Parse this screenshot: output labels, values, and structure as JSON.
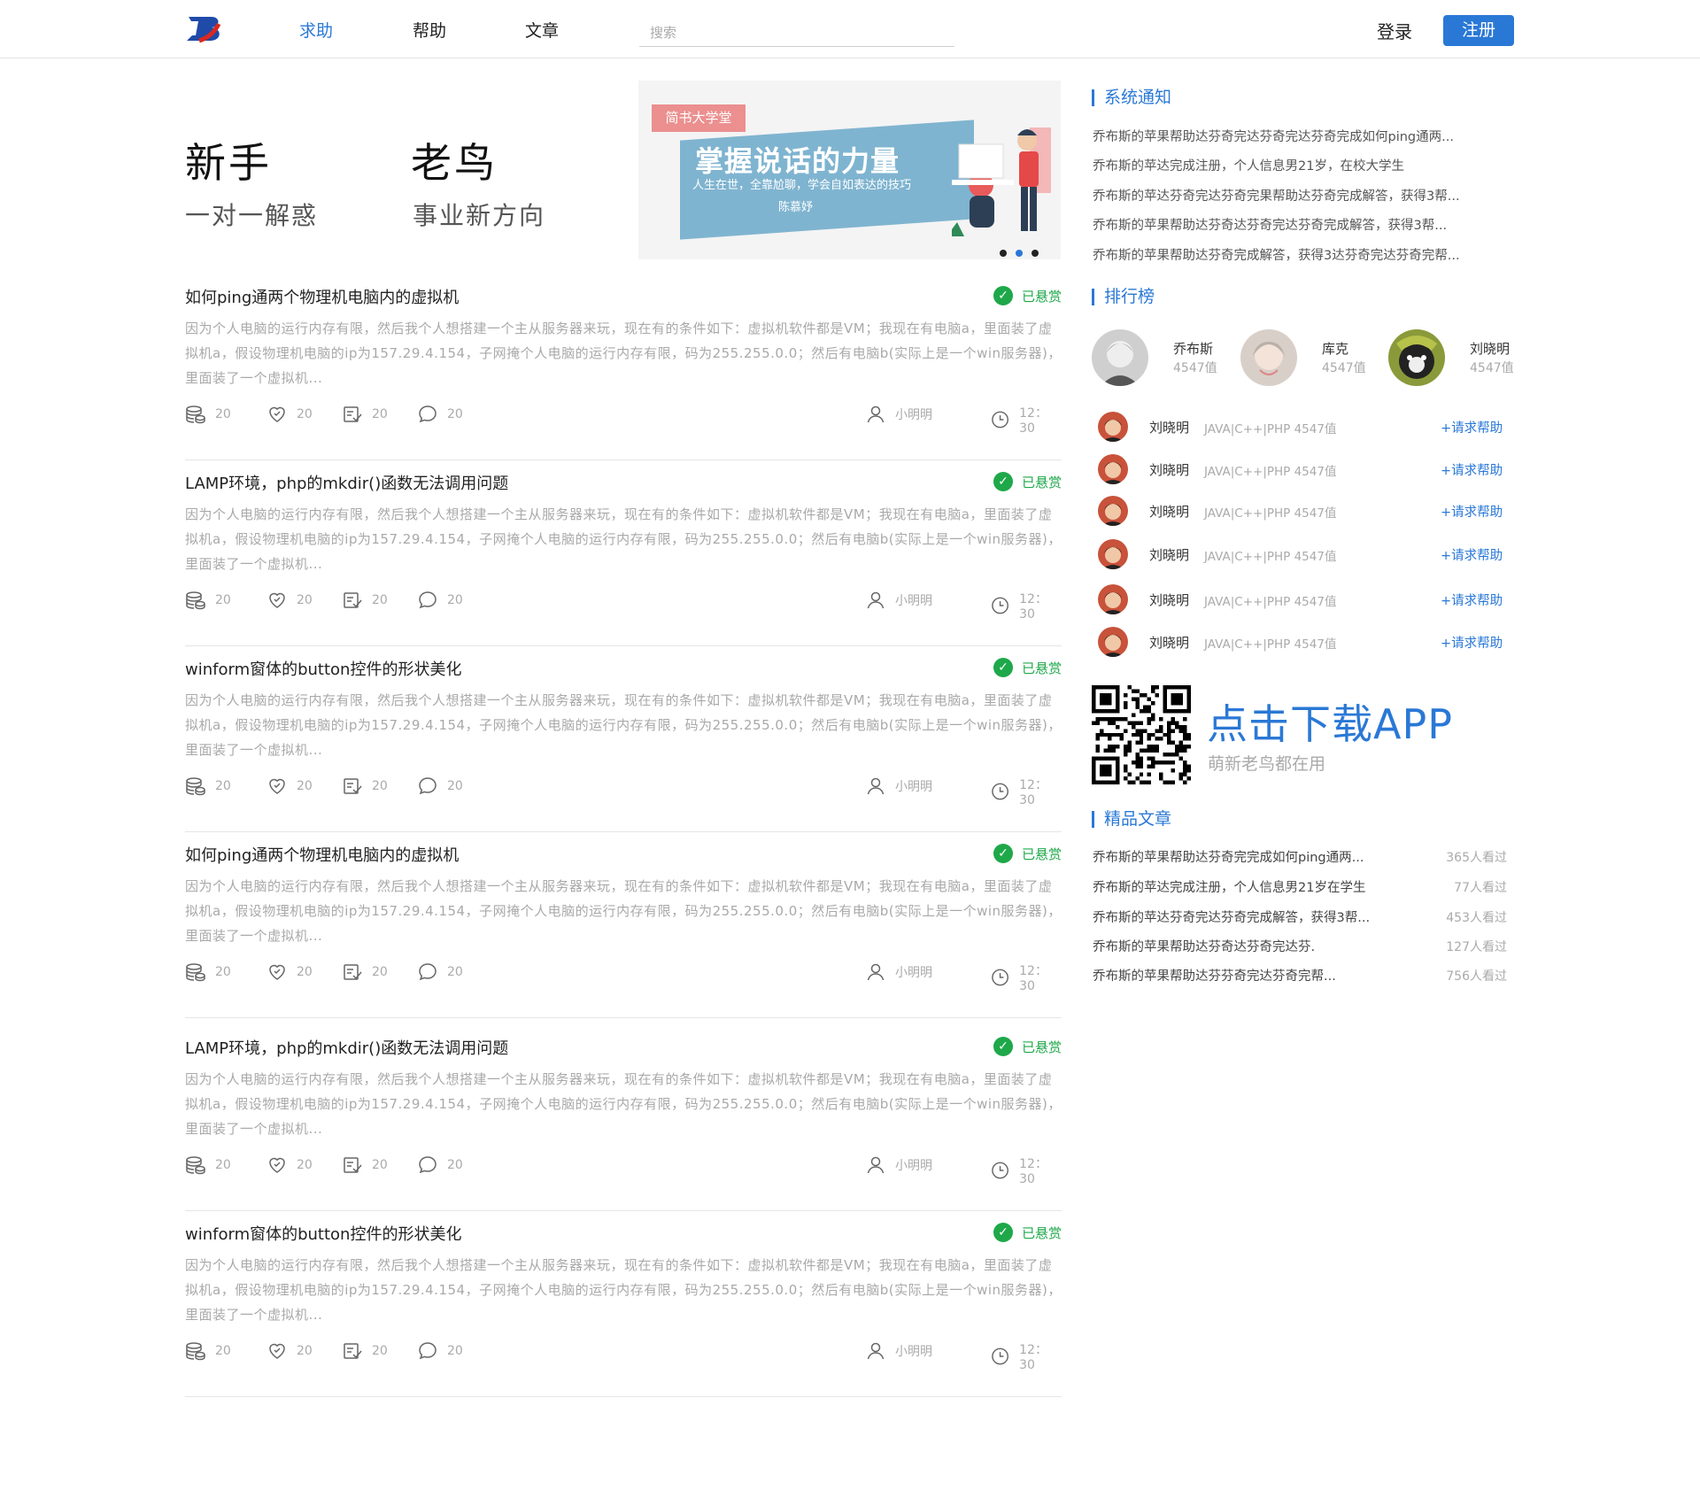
{
  "header": {
    "logo": "B",
    "nav": [
      {
        "label": "求助",
        "active": true
      },
      {
        "label": "帮助",
        "active": false
      },
      {
        "label": "文章",
        "active": false
      }
    ],
    "search_placeholder": "搜索",
    "login_label": "登录",
    "register_label": "注册"
  },
  "hero": {
    "left": {
      "title": "新手",
      "subtitle": "一对一解惑"
    },
    "right": {
      "title": "老鸟",
      "subtitle": "事业新方向"
    },
    "banner": {
      "tag": "简书大学堂",
      "title": "掌握说话的力量",
      "subtitle": "人生在世，全靠尬聊，学会自如表达的技巧",
      "author": "陈慕妤",
      "dots": 3,
      "active_dot": 1
    }
  },
  "posts": [
    {
      "title": "如何ping通两个物理机电脑内的虚拟机",
      "badge": "已悬赏",
      "body": "因为个人电脑的运行内存有限，然后我个人想搭建一个主从服务器来玩，现在有的条件如下：虚拟机软件都是VM；我现在有电脑a，里面装了虚拟机a，假设物理机电脑的ip为157.29.4.154，子网掩个人电脑的运行内存有限，码为255.255.0.0；然后有电脑b(实际上是一个win服务器)，里面装了一个虚拟机...",
      "coins": "20",
      "likes": "20",
      "answers": "20",
      "comments": "20",
      "author": "小明明",
      "time": "12：30"
    },
    {
      "title": "LAMP环境，php的mkdir()函数无法调用问题",
      "badge": "已悬赏",
      "body": "因为个人电脑的运行内存有限，然后我个人想搭建一个主从服务器来玩，现在有的条件如下：虚拟机软件都是VM；我现在有电脑a，里面装了虚拟机a，假设物理机电脑的ip为157.29.4.154，子网掩个人电脑的运行内存有限，码为255.255.0.0；然后有电脑b(实际上是一个win服务器)，里面装了一个虚拟机...",
      "coins": "20",
      "likes": "20",
      "answers": "20",
      "comments": "20",
      "author": "小明明",
      "time": "12：30"
    },
    {
      "title": "winform窗体的button控件的形状美化",
      "badge": "已悬赏",
      "body": "因为个人电脑的运行内存有限，然后我个人想搭建一个主从服务器来玩，现在有的条件如下：虚拟机软件都是VM；我现在有电脑a，里面装了虚拟机a，假设物理机电脑的ip为157.29.4.154，子网掩个人电脑的运行内存有限，码为255.255.0.0；然后有电脑b(实际上是一个win服务器)，里面装了一个虚拟机...",
      "coins": "20",
      "likes": "20",
      "answers": "20",
      "comments": "20",
      "author": "小明明",
      "time": "12：30"
    },
    {
      "title": "如何ping通两个物理机电脑内的虚拟机",
      "badge": "已悬赏",
      "body": "因为个人电脑的运行内存有限，然后我个人想搭建一个主从服务器来玩，现在有的条件如下：虚拟机软件都是VM；我现在有电脑a，里面装了虚拟机a，假设物理机电脑的ip为157.29.4.154，子网掩个人电脑的运行内存有限，码为255.255.0.0；然后有电脑b(实际上是一个win服务器)，里面装了一个虚拟机...",
      "coins": "20",
      "likes": "20",
      "answers": "20",
      "comments": "20",
      "author": "小明明",
      "time": "12：30"
    },
    {
      "title": "LAMP环境，php的mkdir()函数无法调用问题",
      "badge": "已悬赏",
      "body": "因为个人电脑的运行内存有限，然后我个人想搭建一个主从服务器来玩，现在有的条件如下：虚拟机软件都是VM；我现在有电脑a，里面装了虚拟机a，假设物理机电脑的ip为157.29.4.154，子网掩个人电脑的运行内存有限，码为255.255.0.0；然后有电脑b(实际上是一个win服务器)，里面装了一个虚拟机...",
      "coins": "20",
      "likes": "20",
      "answers": "20",
      "comments": "20",
      "author": "小明明",
      "time": "12：30"
    },
    {
      "title": "winform窗体的button控件的形状美化",
      "badge": "已悬赏",
      "body": "因为个人电脑的运行内存有限，然后我个人想搭建一个主从服务器来玩，现在有的条件如下：虚拟机软件都是VM；我现在有电脑a，里面装了虚拟机a，假设物理机电脑的ip为157.29.4.154，子网掩个人电脑的运行内存有限，码为255.255.0.0；然后有电脑b(实际上是一个win服务器)，里面装了一个虚拟机...",
      "coins": "20",
      "likes": "20",
      "answers": "20",
      "comments": "20",
      "author": "小明明",
      "time": "12：30"
    }
  ],
  "sidebar": {
    "notices": {
      "title": "系统通知",
      "items": [
        "乔布斯的苹果帮助达芬奇完达芬奇完达芬奇完成如何ping通两...",
        "乔布斯的苹达完成注册，个人信息男21岁，在校大学生",
        "乔布斯的苹达芬奇完达芬奇完果帮助达芬奇完成解答，获得3帮...",
        "乔布斯的苹果帮助达芬奇达芬奇完达芬奇完成解答，获得3帮...",
        "乔布斯的苹果帮助达芬奇完成解答，获得3达芬奇完达芬奇完帮..."
      ]
    },
    "ranking": {
      "title": "排行榜",
      "top": [
        {
          "name": "乔布斯",
          "score": "4547值"
        },
        {
          "name": "库克",
          "score": "4547值"
        },
        {
          "name": "刘晓明",
          "score": "4547值"
        }
      ],
      "list": [
        {
          "name": "刘晓明",
          "tags": "JAVA|C++|PHP 4547值",
          "action": "+请求帮助"
        },
        {
          "name": "刘晓明",
          "tags": "JAVA|C++|PHP 4547值",
          "action": "+请求帮助"
        },
        {
          "name": "刘晓明",
          "tags": "JAVA|C++|PHP 4547值",
          "action": "+请求帮助"
        },
        {
          "name": "刘晓明",
          "tags": "JAVA|C++|PHP 4547值",
          "action": "+请求帮助"
        },
        {
          "name": "刘晓明",
          "tags": "JAVA|C++|PHP 4547值",
          "action": "+请求帮助"
        },
        {
          "name": "刘晓明",
          "tags": "JAVA|C++|PHP 4547值",
          "action": "+请求帮助"
        }
      ]
    },
    "app": {
      "title": "点击下载APP",
      "subtitle": "萌新老鸟都在用"
    },
    "articles": {
      "title": "精品文章",
      "items": [
        {
          "title": "乔布斯的苹果帮助达芬奇完完成如何ping通两...",
          "views": "365人看过"
        },
        {
          "title": "乔布斯的苹达完成注册，个人信息男21岁在学生",
          "views": "77人看过"
        },
        {
          "title": "乔布斯的苹达芬奇完达芬奇完成解答，获得3帮...",
          "views": "453人看过"
        },
        {
          "title": "乔布斯的苹果帮助达芬奇达芬奇完达芬.",
          "views": "127人看过"
        },
        {
          "title": "乔布斯的苹果帮助达芬芬奇完达芬奇完帮...",
          "views": "756人看过"
        }
      ]
    }
  },
  "colors": {
    "accent": "#2a78d6",
    "success": "#1ea84a",
    "muted": "#aaaaaa",
    "divider": "#e5e5e5"
  },
  "icons": [
    "coins-icon",
    "heart-icon",
    "answer-icon",
    "comment-icon",
    "user-icon",
    "clock-icon",
    "check-icon",
    "qr-code-icon"
  ]
}
